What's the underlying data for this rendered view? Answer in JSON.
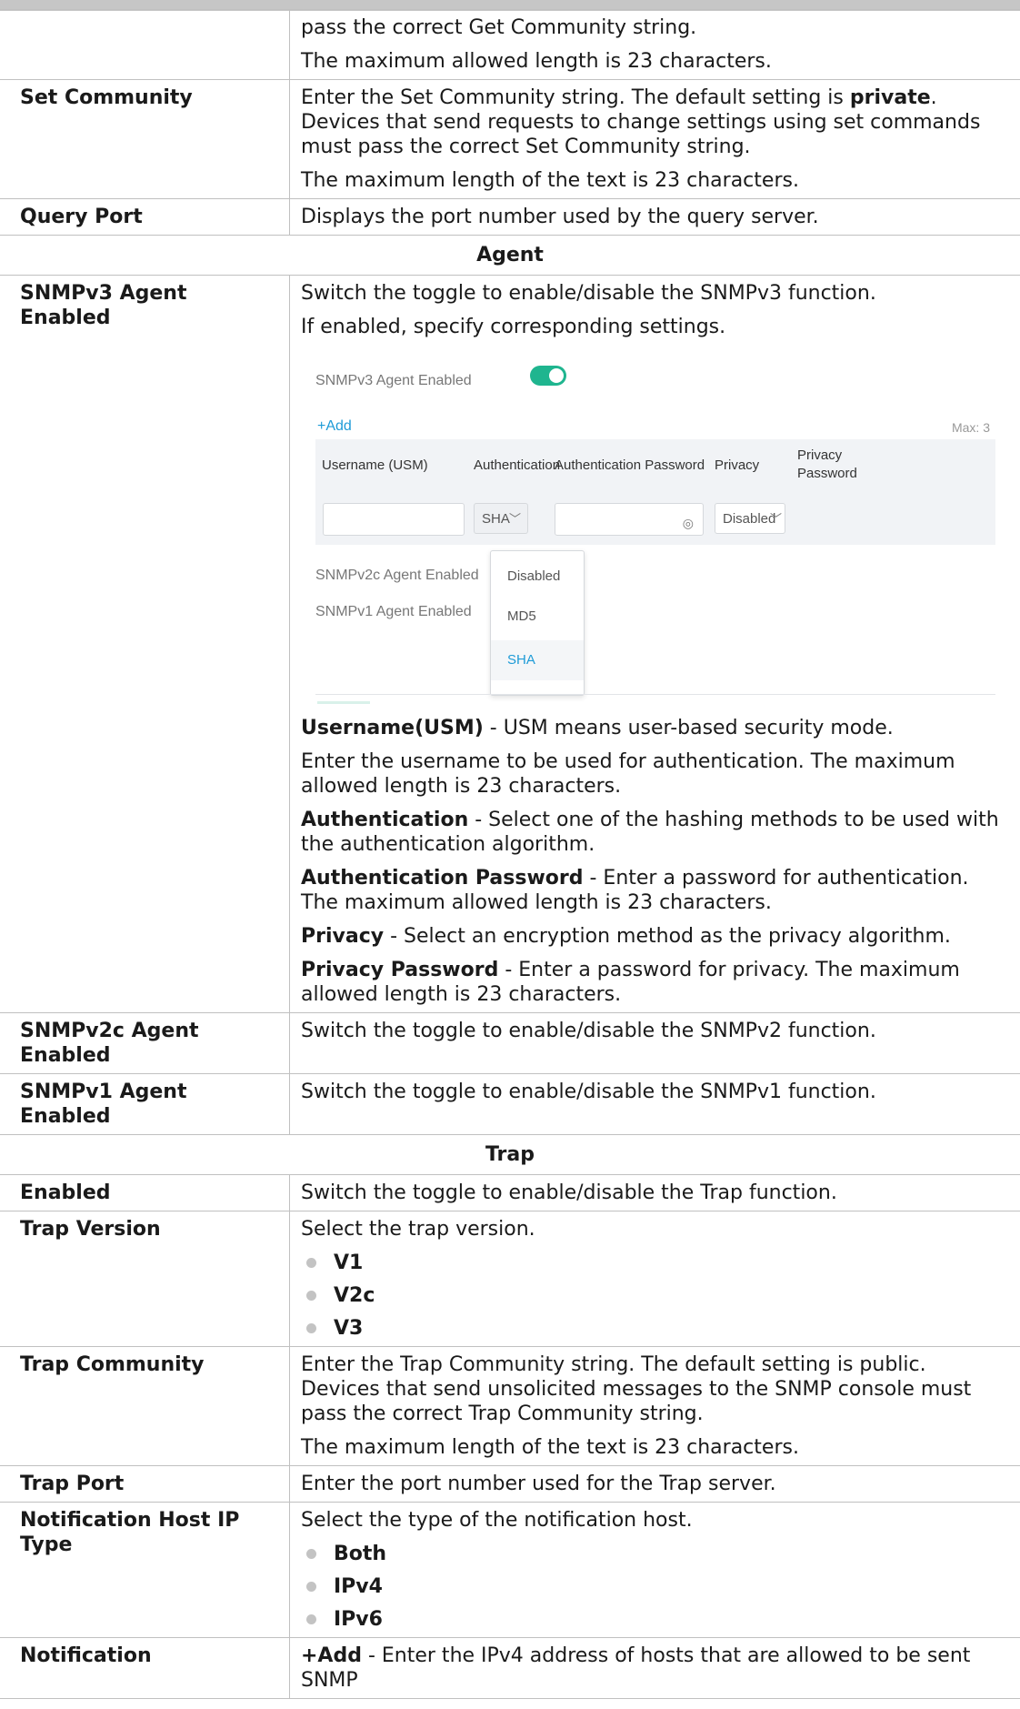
{
  "rows": {
    "top": {
      "lines": [
        "pass the correct Get Community string.",
        "The maximum allowed length is 23 characters."
      ]
    },
    "set_community": {
      "label": "Set Community",
      "pre": "Enter the Set Community string. The default setting is ",
      "bold": "private",
      "post": ". Devices that send requests to change settings using set commands must pass the correct Set Community string.",
      "line2": "The maximum length of the text is 23 characters."
    },
    "query_port": {
      "label": "Query Port",
      "desc": "Displays the port number used by the query server."
    },
    "agent_header": "Agent",
    "snmpv3": {
      "label": "SNMPv3 Agent Enabled",
      "line1": "Switch the toggle to enable/disable the SNMPv3 function.",
      "line2": "If enabled, specify corresponding settings.",
      "defs": [
        {
          "term": "Username(USM)",
          "text": " - USM means user-based security mode."
        },
        {
          "term": "",
          "text": "Enter the username to be used for authentication. The maximum allowed length is 23 characters."
        },
        {
          "term": "Authentication",
          "text": " - Select one of the hashing methods to be used with the authentication algorithm."
        },
        {
          "term": "Authentication Password",
          "text": " - Enter a password for authentication. The maximum allowed length is 23 characters."
        },
        {
          "term": "Privacy",
          "text": " - Select an encryption method as the privacy algorithm."
        },
        {
          "term": "Privacy Password",
          "text": " - Enter a password for privacy. The maximum allowed length is 23 characters."
        }
      ]
    },
    "snmpv2c": {
      "label": "SNMPv2c Agent Enabled",
      "desc": "Switch the toggle to enable/disable the SNMPv2 function."
    },
    "snmpv1": {
      "label": "SNMPv1 Agent Enabled",
      "desc": "Switch the toggle to enable/disable the SNMPv1 function."
    },
    "trap_header": "Trap",
    "enabled": {
      "label": "Enabled",
      "desc": "Switch the toggle to enable/disable the Trap function."
    },
    "trap_version": {
      "label": "Trap Version",
      "desc": "Select the trap version.",
      "options": [
        "V1",
        "V2c",
        "V3"
      ]
    },
    "trap_community": {
      "label": "Trap Community",
      "line1": "Enter the Trap Community string. The default setting is public. Devices that send unsolicited messages to the SNMP console must pass the correct Trap Community string.",
      "line2": "The maximum length of the text is 23 characters."
    },
    "trap_port": {
      "label": "Trap Port",
      "desc": "Enter the port number used for the Trap server."
    },
    "notif_ip_type": {
      "label": "Notification Host IP Type",
      "desc": "Select the type of the notification host.",
      "options": [
        "Both",
        "IPv4",
        "IPv6"
      ]
    },
    "notification": {
      "label": "Notification",
      "bold": "+Add",
      "desc": " - Enter the IPv4 address of hosts that are allowed to be sent SNMP"
    }
  },
  "mock": {
    "v3_label": "SNMPv3 Agent Enabled",
    "toggle_on": true,
    "add": "+Add",
    "max": "Max: 3",
    "col_username": "Username (USM)",
    "col_auth": "Authentication",
    "col_auth_pw": "Authentication Password",
    "col_privacy": "Privacy",
    "col_privacy_pw_1": "Privacy",
    "col_privacy_pw_2": "Password",
    "auth_value": "SHA",
    "privacy_value": "Disabled",
    "v2c_label": "SNMPv2c Agent Enabled",
    "v1_label": "SNMPv1 Agent Enabled",
    "dropdown": [
      "Disabled",
      "MD5",
      "SHA"
    ],
    "dropdown_selected": "SHA",
    "accent": "#1fb58f",
    "link_color": "#1e9bd7"
  }
}
